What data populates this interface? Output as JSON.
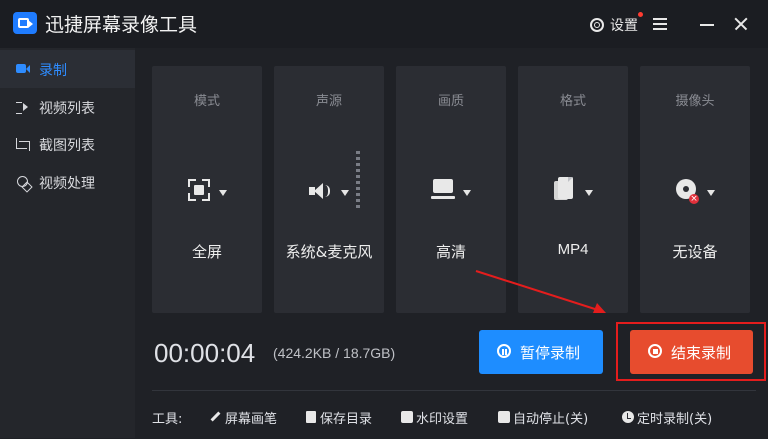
{
  "app": {
    "title": "迅捷屏幕录像工具",
    "settings_label": "设置"
  },
  "sidebar": {
    "items": [
      {
        "label": "录制",
        "active": true
      },
      {
        "label": "视频列表"
      },
      {
        "label": "截图列表"
      },
      {
        "label": "视频处理"
      }
    ]
  },
  "cards": [
    {
      "title": "模式",
      "value": "全屏",
      "icon": "fullscreen-icon"
    },
    {
      "title": "声源",
      "value": "系统&麦克风",
      "icon": "speaker-icon"
    },
    {
      "title": "画质",
      "value": "高清",
      "icon": "monitor-icon"
    },
    {
      "title": "格式",
      "value": "MP4",
      "icon": "file-icon"
    },
    {
      "title": "摄像头",
      "value": "无设备",
      "icon": "webcam-icon"
    }
  ],
  "recording": {
    "time": "00:00:04",
    "size_info": "(424.2KB / 18.7GB)"
  },
  "buttons": {
    "pause": "暂停录制",
    "stop": "结束录制"
  },
  "tools": {
    "label": "工具:",
    "items": [
      "屏幕画笔",
      "保存目录",
      "水印设置",
      "自动停止(关)",
      "定时录制(关)"
    ]
  },
  "colors": {
    "accent": "#2e8cff",
    "pause_button": "#1e8dff",
    "stop_button": "#e74c2e",
    "annotation": "#e41d1d"
  }
}
